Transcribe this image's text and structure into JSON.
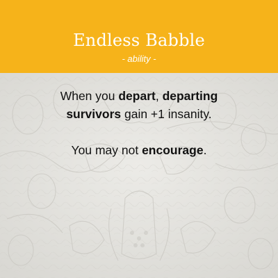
{
  "card": {
    "title": "Endless Babble",
    "subtitle": "- ability -",
    "rules": [
      {
        "segments": [
          {
            "text": "When you ",
            "bold": false
          },
          {
            "text": "depart",
            "bold": true
          },
          {
            "text": ", ",
            "bold": false
          },
          {
            "text": "departing",
            "bold": true
          },
          {
            "text": "\n",
            "bold": false
          },
          {
            "text": "survivors",
            "bold": true
          },
          {
            "text": " gain +1 insanity.",
            "bold": false
          }
        ]
      },
      {
        "segments": [
          {
            "text": "You may not ",
            "bold": false
          },
          {
            "text": "encourage",
            "bold": true
          },
          {
            "text": ".",
            "bold": false
          }
        ]
      }
    ]
  },
  "colors": {
    "header": "#f6b31a",
    "title_text": "#ffffff",
    "body_text": "#111111",
    "art_background": "#e4e3df"
  }
}
